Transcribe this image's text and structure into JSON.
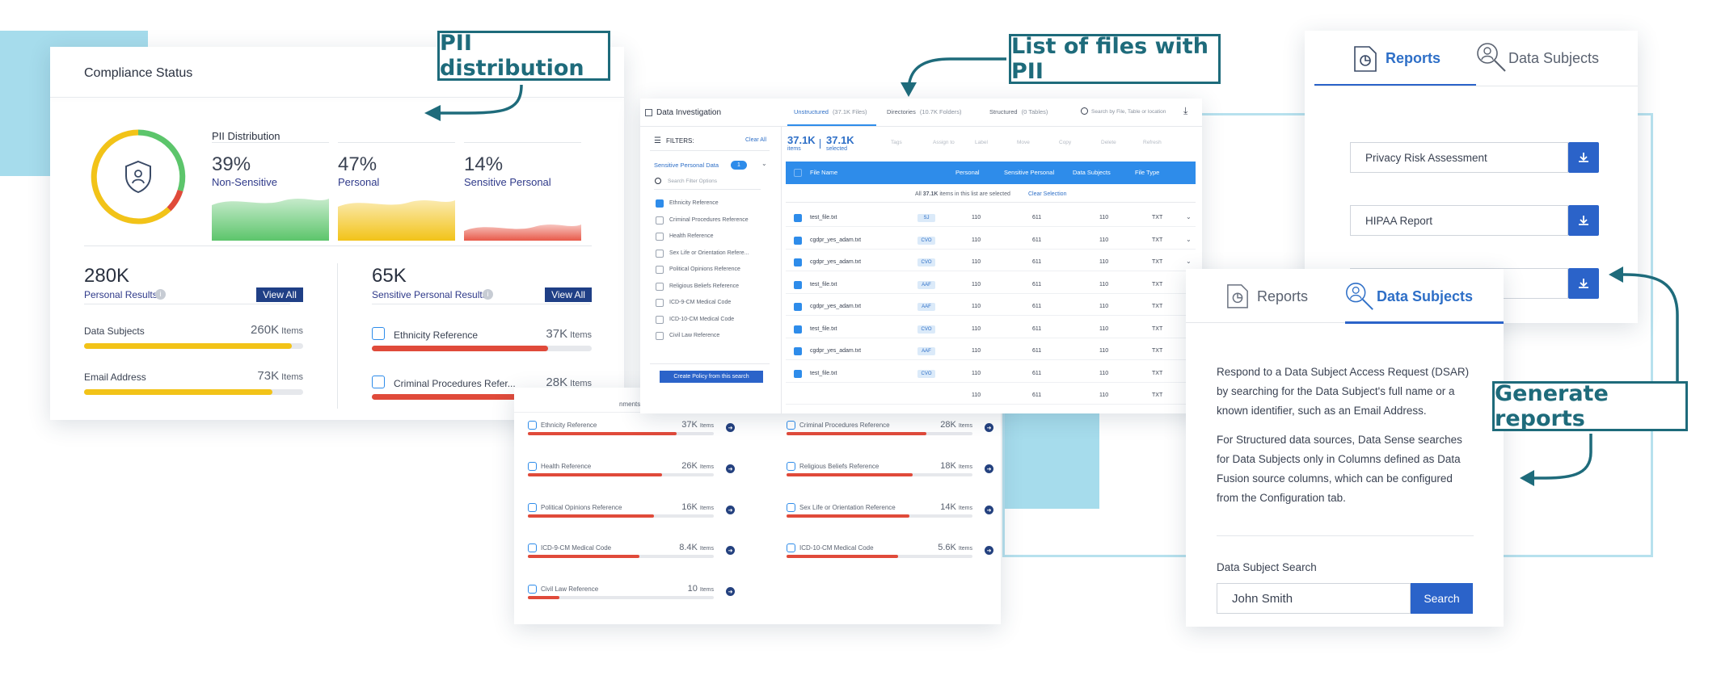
{
  "callouts": {
    "pii_distribution": "PII distribution",
    "list_files": "List of files with PII",
    "generate_reports": "Generate reports"
  },
  "compliance": {
    "title": "Compliance Status",
    "pii_heading": "PII Distribution",
    "dist": [
      {
        "pct": "39%",
        "label": "Non-Sensitive",
        "color": "#5cc56b"
      },
      {
        "pct": "47%",
        "label": "Personal",
        "color": "#f2c318"
      },
      {
        "pct": "14%",
        "label": "Sensitive Personal",
        "color": "#e85a4a"
      }
    ],
    "personal": {
      "count": "280K",
      "label": "Personal Results",
      "view_all": "View All"
    },
    "sensitive": {
      "count": "65K",
      "label": "Sensitive Personal Results",
      "view_all": "View All"
    },
    "personal_rows": [
      {
        "label": "Data Subjects",
        "value": "260K",
        "unit": "Items",
        "fill": 0.95
      },
      {
        "label": "Email Address",
        "value": "73K",
        "unit": "Items",
        "fill": 0.86
      }
    ],
    "sensitive_rows": [
      {
        "label": "Ethnicity Reference",
        "value": "37K",
        "unit": "Items",
        "fill": 0.8
      },
      {
        "label": "Criminal Procedures Refer...",
        "value": "28K",
        "unit": "Items",
        "fill": 0.78
      }
    ]
  },
  "investigation": {
    "title": "Data Investigation",
    "tabs": [
      {
        "label": "Unstructured",
        "count": "(37.1K Files)"
      },
      {
        "label": "Directories",
        "count": "(10.7K Folders)"
      },
      {
        "label": "Structured",
        "count": "(0 Tables)"
      }
    ],
    "search_placeholder": "Search by File, Table or location",
    "filters_label": "FILTERS:",
    "clear_all": "Clear All",
    "filter_group": "Sensitive Personal Data",
    "filter_badge": "1",
    "filter_search": "Search Filter Options",
    "filter_options": [
      {
        "label": "Ethnicity Reference",
        "checked": true
      },
      {
        "label": "Criminal Procedures Reference",
        "checked": false
      },
      {
        "label": "Health Reference",
        "checked": false
      },
      {
        "label": "Sex Life or Orientation Refere...",
        "checked": false
      },
      {
        "label": "Political Opinions Reference",
        "checked": false
      },
      {
        "label": "Religious Beliefs Reference",
        "checked": false
      },
      {
        "label": "ICD-9-CM Medical Code",
        "checked": false
      },
      {
        "label": "ICD-10-CM Medical Code",
        "checked": false
      },
      {
        "label": "Civil Law Reference",
        "checked": false
      }
    ],
    "create_policy": "Create Policy from this search",
    "items_count": "37.1K",
    "items_label": "items",
    "selected_count": "37.1K",
    "selected_label": "selected",
    "toolbar": [
      "Tags",
      "Assign to",
      "Label",
      "Move",
      "Copy",
      "Delete",
      "Refresh"
    ],
    "columns": [
      "File Name",
      "Personal",
      "Sensitive Personal",
      "Data Subjects",
      "File Type"
    ],
    "selection_note_pre": "All",
    "selection_note_count": "37.1K",
    "selection_note_post": "items in this list are selected",
    "clear_selection": "Clear Selection",
    "rows": [
      {
        "name": "test_file.txt",
        "tag": "SJ",
        "personal": "110",
        "sensitive": "611",
        "subjects": "110",
        "type": "TXT"
      },
      {
        "name": "cgdpr_yes_adam.txt",
        "tag": "CVO",
        "personal": "110",
        "sensitive": "611",
        "subjects": "110",
        "type": "TXT"
      },
      {
        "name": "cgdpr_yes_adam.txt",
        "tag": "CVO",
        "personal": "110",
        "sensitive": "611",
        "subjects": "110",
        "type": "TXT"
      },
      {
        "name": "test_file.txt",
        "tag": "AAF",
        "personal": "110",
        "sensitive": "611",
        "subjects": "110",
        "type": "TXT"
      },
      {
        "name": "cgdpr_yes_adam.txt",
        "tag": "AAF",
        "personal": "110",
        "sensitive": "611",
        "subjects": "110",
        "type": "TXT"
      },
      {
        "name": "test_file.txt",
        "tag": "CVO",
        "personal": "110",
        "sensitive": "611",
        "subjects": "110",
        "type": "TXT"
      },
      {
        "name": "cgdpr_yes_adam.txt",
        "tag": "AAF",
        "personal": "110",
        "sensitive": "611",
        "subjects": "110",
        "type": "TXT"
      },
      {
        "name": "test_file.txt",
        "tag": "CVO",
        "personal": "110",
        "sensitive": "611",
        "subjects": "110",
        "type": "TXT"
      },
      {
        "name": "",
        "tag": "",
        "personal": "110",
        "sensitive": "611",
        "subjects": "110",
        "type": "TXT"
      }
    ]
  },
  "sensitive_panel": {
    "header_fragment": "nments",
    "items": [
      {
        "label": "Ethnicity Reference",
        "value": "37K",
        "unit": "Items",
        "fill": 0.8
      },
      {
        "label": "Criminal Procedures Reference",
        "value": "28K",
        "unit": "Items",
        "fill": 0.75
      },
      {
        "label": "Health Reference",
        "value": "26K",
        "unit": "Items",
        "fill": 0.72
      },
      {
        "label": "Religious Beliefs Reference",
        "value": "18K",
        "unit": "Items",
        "fill": 0.68
      },
      {
        "label": "Political Opinions Reference",
        "value": "16K",
        "unit": "Items",
        "fill": 0.68
      },
      {
        "label": "Sex Life or Orientation Reference",
        "value": "14K",
        "unit": "Items",
        "fill": 0.66
      },
      {
        "label": "ICD-9-CM Medical Code",
        "value": "8.4K",
        "unit": "Items",
        "fill": 0.6
      },
      {
        "label": "ICD-10-CM Medical Code",
        "value": "5.6K",
        "unit": "Items",
        "fill": 0.6
      },
      {
        "label": "Civil Law Reference",
        "value": "10",
        "unit": "Items",
        "fill": 0.17
      }
    ]
  },
  "reports_panel": {
    "tab_reports": "Reports",
    "tab_subjects": "Data Subjects",
    "reports": [
      "Privacy Risk Assessment",
      "HIPAA Report",
      ""
    ]
  },
  "subjects_panel": {
    "tab_reports": "Reports",
    "tab_subjects": "Data Subjects",
    "para1": "Respond to a Data Subject Access Request (DSAR) by searching for the Data Subject's full name or a known identifier, such as an Email Address.",
    "para2": "For Structured data sources, Data Sense searches for Data Subjects only in Columns defined as Data Fusion source columns, which can be configured from the Configuration tab.",
    "search_label": "Data Subject Search",
    "search_value": "John Smith",
    "search_button": "Search"
  },
  "colors": {
    "accent": "#2e8cea",
    "navy": "#1f3f86",
    "teal": "#1e6b7b",
    "red": "#e04a3a",
    "yellow": "#f2c318"
  }
}
